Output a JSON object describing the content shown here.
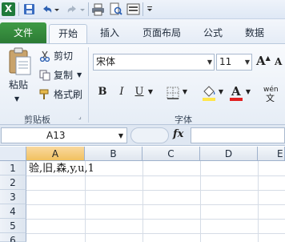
{
  "quick_access": {
    "app_icon": "excel-icon",
    "app_letter": "X",
    "icons": [
      "save-icon",
      "undo-icon",
      "redo-icon",
      "print-icon",
      "print-preview-icon",
      "screen-icon",
      "customize-icon"
    ]
  },
  "tabs": {
    "file": "文件",
    "home": "开始",
    "insert": "插入",
    "page_layout": "页面布局",
    "formulas": "公式",
    "data": "数据"
  },
  "clipboard": {
    "paste": "粘贴",
    "cut": "剪切",
    "copy": "复制",
    "format_painter": "格式刷",
    "group_label": "剪贴板"
  },
  "font": {
    "name": "宋体",
    "size": "11",
    "bold": "B",
    "italic": "I",
    "underline": "U",
    "group_label": "字体",
    "phonetic": "wén",
    "highlight_color": "#ffe64a",
    "font_color": "#e02020"
  },
  "formula_bar": {
    "name_box": "A13",
    "fx": "fx",
    "value": ""
  },
  "sheet": {
    "columns": [
      "A",
      "B",
      "C",
      "D",
      "E"
    ],
    "rows": [
      "1",
      "2",
      "3",
      "4",
      "5",
      "6"
    ],
    "selected_column": "A",
    "cell_A1": "验,旧,森,y,u,1"
  }
}
